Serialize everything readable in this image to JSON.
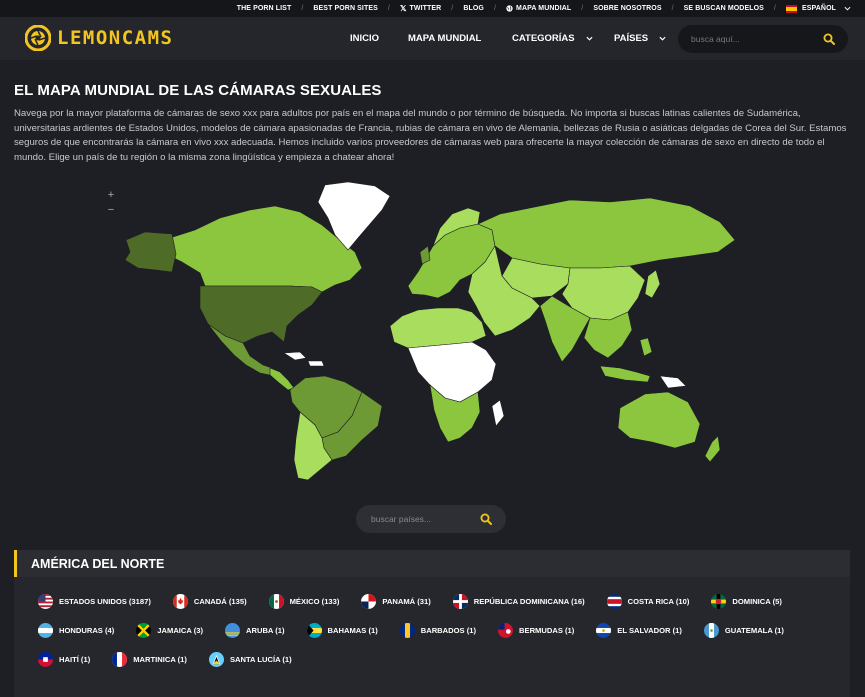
{
  "topbar": {
    "items": [
      {
        "label": "THE PORN LIST"
      },
      {
        "label": "BEST PORN SITES"
      },
      {
        "label": "TWITTER"
      },
      {
        "label": "BLOG"
      },
      {
        "label": "MAPA MUNDIAL"
      },
      {
        "label": "SOBRE NOSOTROS"
      },
      {
        "label": "SE BUSCAN MODELOS"
      },
      {
        "label": "ESPAÑOL"
      }
    ]
  },
  "header": {
    "logo_text": "LEMONCAMS",
    "nav": [
      {
        "label": "INICIO"
      },
      {
        "label": "MAPA MUNDIAL"
      },
      {
        "label": "CATEGORÍAS"
      },
      {
        "label": "PAÍSES"
      }
    ],
    "search_placeholder": "busca aquí..."
  },
  "main": {
    "title": "EL MAPA MUNDIAL DE LAS CÁMARAS SEXUALES",
    "intro": "Navega por la mayor plataforma de cámaras de sexo xxx para adultos por país en el mapa del mundo o por término de búsqueda. No importa si buscas latinas calientes de Sudamérica, universitarias ardientes de Estados Unidos, modelos de cámara apasionadas de Francia, rubias de cámara en vivo de Alemania, bellezas de Rusia o asiáticas delgadas de Corea del Sur. Estamos seguros de que encontrarás la cámara en vivo xxx adecuada. Hemos incluido varios proveedores de cámaras web para ofrecerte la mayor colección de cámaras de sexo en directo de todo el mundo. Elige un país de tu región o la misma zona lingüística y empieza a chatear ahora!",
    "map": {
      "zoom_in": "+",
      "zoom_out": "−",
      "colors": {
        "top": "#4e6b27",
        "high": "#6d9a34",
        "mid": "#8cc63f",
        "low": "#a9dd5e",
        "none": "#ffffff",
        "background": "#1e1f24"
      }
    },
    "country_search_placeholder": "buscar países..."
  },
  "region": {
    "title": "AMÉRICA DEL NORTE",
    "countries": [
      {
        "label": "ESTADOS UNIDOS (3187)",
        "flag": "us-flag-icon"
      },
      {
        "label": "CANADÁ (135)",
        "flag": "canada-flag-icon"
      },
      {
        "label": "MÉXICO (133)",
        "flag": "mexico-flag-icon"
      },
      {
        "label": "PANAMÁ (31)",
        "flag": "panama-flag-icon"
      },
      {
        "label": "REPÚBLICA DOMINICANA (16)",
        "flag": "dominican-republic-flag-icon"
      },
      {
        "label": "COSTA RICA (10)",
        "flag": "costa-rica-flag-icon"
      },
      {
        "label": "DOMINICA (5)",
        "flag": "dominica-flag-icon"
      },
      {
        "label": "HONDURAS (4)",
        "flag": "honduras-flag-icon"
      },
      {
        "label": "JAMAICA (3)",
        "flag": "jamaica-flag-icon"
      },
      {
        "label": "ARUBA (1)",
        "flag": "aruba-flag-icon"
      },
      {
        "label": "BAHAMAS (1)",
        "flag": "bahamas-flag-icon"
      },
      {
        "label": "BARBADOS (1)",
        "flag": "barbados-flag-icon"
      },
      {
        "label": "BERMUDAS (1)",
        "flag": "bermuda-flag-icon"
      },
      {
        "label": "EL SALVADOR (1)",
        "flag": "el-salvador-flag-icon"
      },
      {
        "label": "GUATEMALA (1)",
        "flag": "guatemala-flag-icon"
      },
      {
        "label": "HAITÍ (1)",
        "flag": "haiti-flag-icon"
      },
      {
        "label": "MARTINICA (1)",
        "flag": "martinique-flag-icon"
      },
      {
        "label": "SANTA LUCÍA (1)",
        "flag": "saint-lucia-flag-icon"
      }
    ]
  }
}
